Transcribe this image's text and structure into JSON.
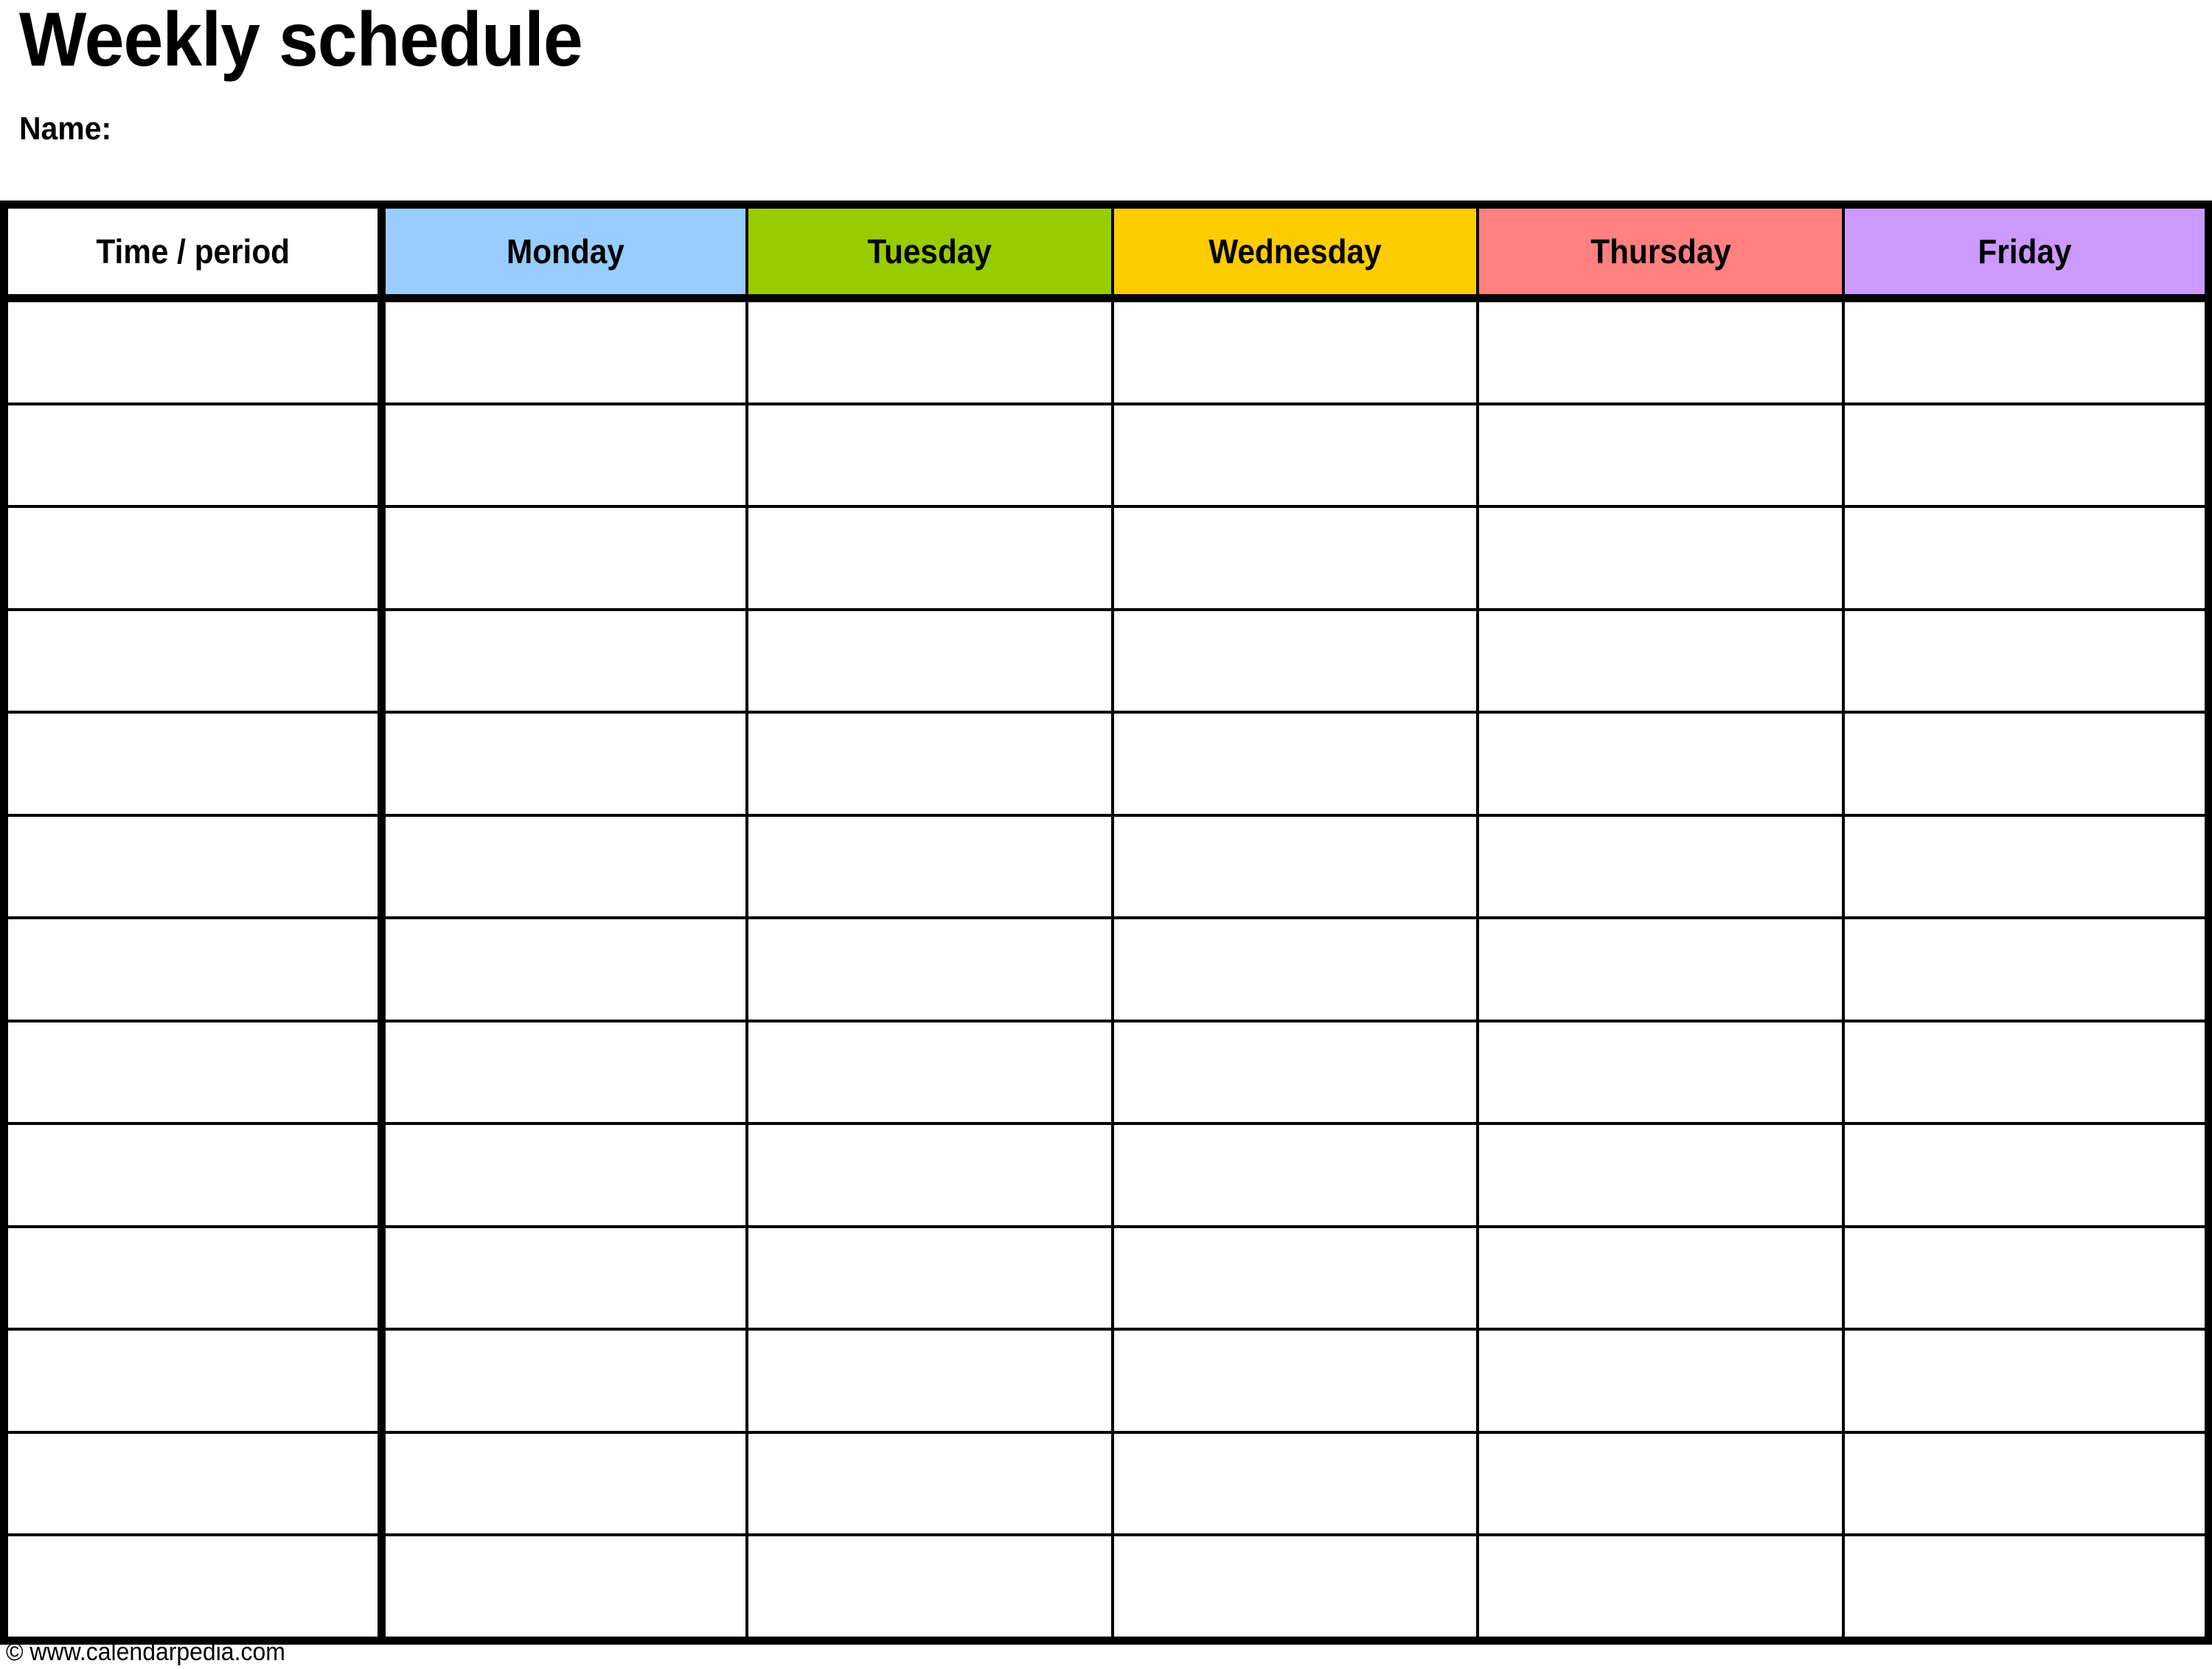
{
  "document": {
    "title": "Weekly schedule",
    "name_label": "Name:"
  },
  "table": {
    "columns": [
      {
        "key": "time",
        "label": "Time / period",
        "bg": "#ffffff"
      },
      {
        "key": "monday",
        "label": "Monday",
        "bg": "#99ccff"
      },
      {
        "key": "tuesday",
        "label": "Tuesday",
        "bg": "#99cc00"
      },
      {
        "key": "wednesday",
        "label": "Wednesday",
        "bg": "#ffcc00"
      },
      {
        "key": "thursday",
        "label": "Thursday",
        "bg": "#ff8080"
      },
      {
        "key": "friday",
        "label": "Friday",
        "bg": "#cc99ff"
      }
    ],
    "row_count": 13,
    "rows": [
      {
        "time": "",
        "monday": "",
        "tuesday": "",
        "wednesday": "",
        "thursday": "",
        "friday": ""
      },
      {
        "time": "",
        "monday": "",
        "tuesday": "",
        "wednesday": "",
        "thursday": "",
        "friday": ""
      },
      {
        "time": "",
        "monday": "",
        "tuesday": "",
        "wednesday": "",
        "thursday": "",
        "friday": ""
      },
      {
        "time": "",
        "monday": "",
        "tuesday": "",
        "wednesday": "",
        "thursday": "",
        "friday": ""
      },
      {
        "time": "",
        "monday": "",
        "tuesday": "",
        "wednesday": "",
        "thursday": "",
        "friday": ""
      },
      {
        "time": "",
        "monday": "",
        "tuesday": "",
        "wednesday": "",
        "thursday": "",
        "friday": ""
      },
      {
        "time": "",
        "monday": "",
        "tuesday": "",
        "wednesday": "",
        "thursday": "",
        "friday": ""
      },
      {
        "time": "",
        "monday": "",
        "tuesday": "",
        "wednesday": "",
        "thursday": "",
        "friday": ""
      },
      {
        "time": "",
        "monday": "",
        "tuesday": "",
        "wednesday": "",
        "thursday": "",
        "friday": ""
      },
      {
        "time": "",
        "monday": "",
        "tuesday": "",
        "wednesday": "",
        "thursday": "",
        "friday": ""
      },
      {
        "time": "",
        "monday": "",
        "tuesday": "",
        "wednesday": "",
        "thursday": "",
        "friday": ""
      },
      {
        "time": "",
        "monday": "",
        "tuesday": "",
        "wednesday": "",
        "thursday": "",
        "friday": ""
      },
      {
        "time": "",
        "monday": "",
        "tuesday": "",
        "wednesday": "",
        "thursday": "",
        "friday": ""
      }
    ]
  },
  "footer": {
    "copyright": "© www.calendarpedia.com"
  },
  "colors": {
    "border": "#000000",
    "text": "#000000",
    "page_background": "#ffffff",
    "monday": "#99ccff",
    "tuesday": "#99cc00",
    "wednesday": "#ffcc00",
    "thursday": "#ff8080",
    "friday": "#cc99ff"
  }
}
